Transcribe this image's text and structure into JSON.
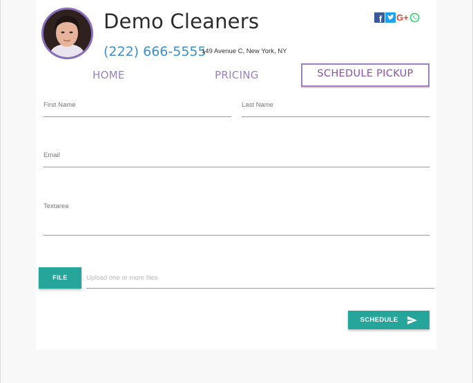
{
  "business": {
    "name": "Demo Cleaners",
    "phone": "(222) 666-5555",
    "address": "149 Avenue C, New York, NY"
  },
  "social": {
    "icons": [
      "facebook-icon",
      "twitter-icon",
      "google-plus-icon",
      "whatsapp-icon"
    ],
    "google_plus_text": "G+",
    "facebook_letter": "f",
    "colors": {
      "facebook": "#3b5998",
      "twitter": "#1da1f2",
      "google_plus": "#dd4b39",
      "whatsapp": "#25d366"
    }
  },
  "nav": {
    "home": "HOME",
    "pricing": "PRICING",
    "schedule": "SCHEDULE PICKUP"
  },
  "form": {
    "first_name_label": "First Name",
    "last_name_label": "Last Name",
    "email_label": "Email",
    "textarea_label": "Textarea",
    "file_button": "FILE",
    "file_placeholder": "Upload one or more files",
    "submit_button": "SCHEDULE"
  },
  "colors": {
    "accent": "#26a69a",
    "nav": "#9b7fc2",
    "phone": "#3a8fd0"
  }
}
